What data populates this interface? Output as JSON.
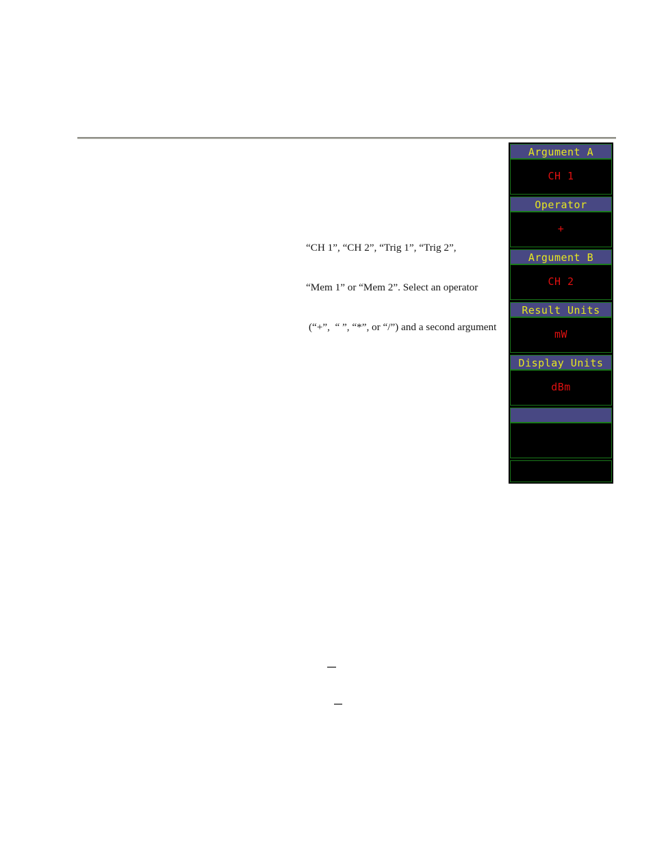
{
  "document": {
    "paragraph_lines": [
      "“CH 1”, “CH 2”, “Trig 1”, “Trig 2”,",
      "“Mem 1” or “Mem 2”. Select an operator",
      "(“+”,  “ ”, “*”, or “/”) and a second argument"
    ],
    "rule_color": "#8c8c84",
    "background_color": "#ffffff",
    "text_color": "#161616"
  },
  "softkey_menu": {
    "colors": {
      "panel_background": "#000000",
      "cell_border": "#1a7a1a",
      "header_background": "#484883",
      "header_text": "#e8e820",
      "value_text": "#e01010",
      "value_background": "#000000"
    },
    "groups": [
      {
        "label": "Argument A",
        "value": "CH 1"
      },
      {
        "label": "Operator",
        "value": "+"
      },
      {
        "label": "Argument B",
        "value": "CH 2"
      },
      {
        "label": "Result Units",
        "value": "mW"
      },
      {
        "label": "Display Units",
        "value": "dBm"
      },
      {
        "label": "",
        "value": ""
      }
    ],
    "trailing_cell": ""
  }
}
